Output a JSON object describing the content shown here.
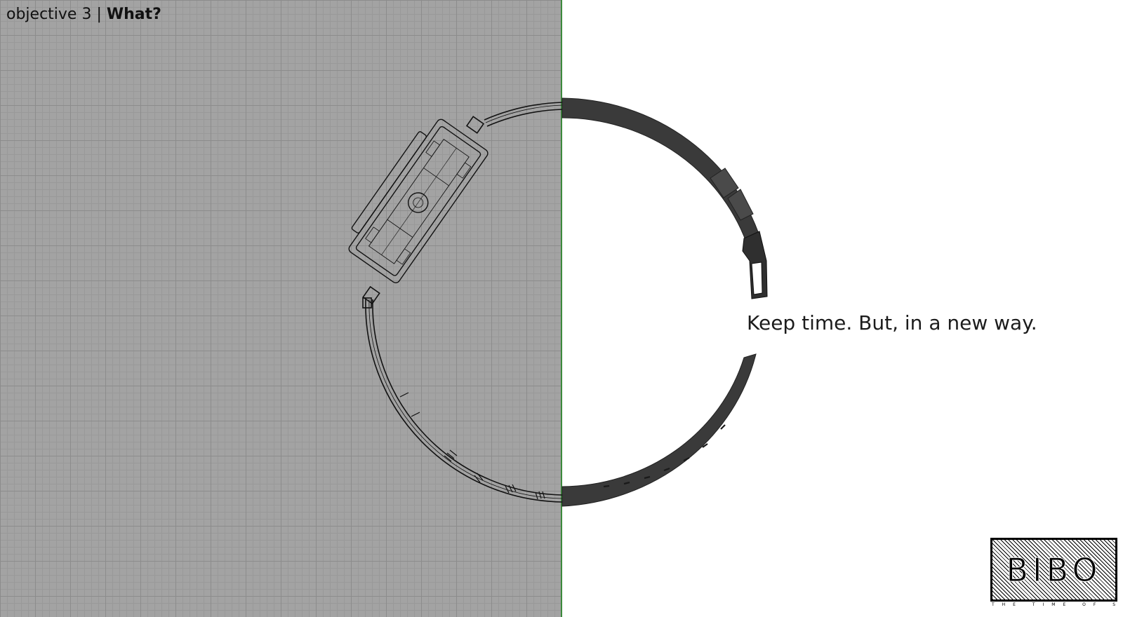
{
  "header": {
    "prefix": "objective 3 | ",
    "title": "What?"
  },
  "tagline": "Keep time. But, in a new way.",
  "logo": {
    "word": "BIBO",
    "subtitle": "THE TIME OF SUN"
  },
  "colors": {
    "grid_background": "#a3a3a3",
    "divider": "#3d8a3d",
    "band": "#3a3a3a"
  },
  "icons": {
    "watch": "watch-band-render-icon"
  }
}
